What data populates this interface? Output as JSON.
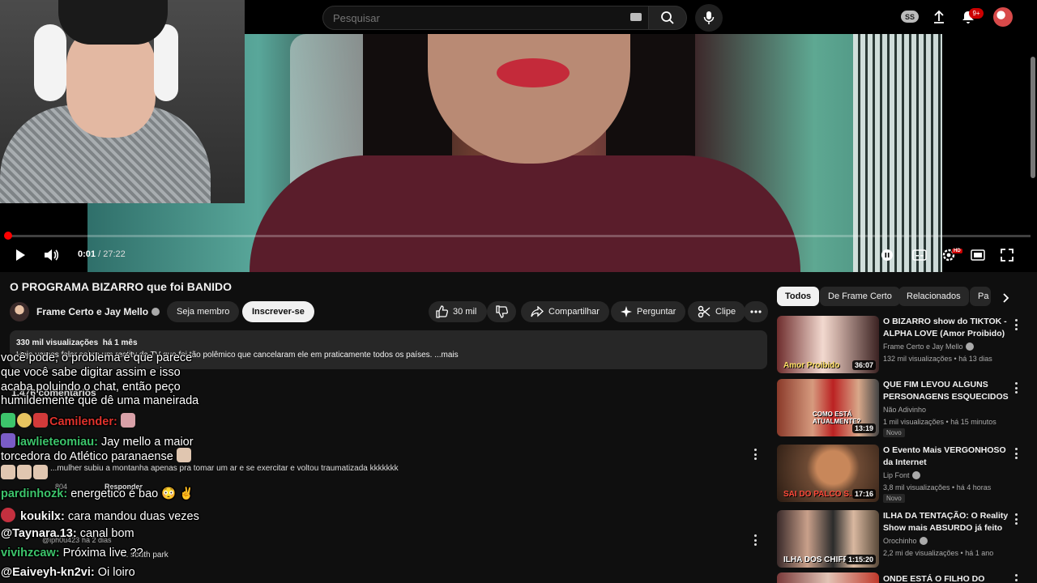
{
  "search": {
    "placeholder": "Pesquisar"
  },
  "topbar": {
    "cast_badge": "SS",
    "notifications": "9+"
  },
  "player": {
    "current_time": "0:01",
    "duration": "27:22",
    "progress": 0.0006
  },
  "video": {
    "title": "O PROGRAMA BIZARRO que foi BANIDO",
    "channel": "Frame Certo e Jay Mello",
    "member_label": "Seja membro",
    "subscribe_label": "Inscrever-se",
    "likes": "30 mil",
    "share_label": "Compartilhar",
    "ask_label": "Perguntar",
    "clip_label": "Clipe",
    "views": "330 mil visualizações",
    "age": "há 1 mês",
    "description": "Hoje vamos falar sobre um reality da TV que foi tão polêmico que cancelaram ele em praticamente todos os países. ...mais"
  },
  "comments": {
    "count_label": "1.476 comentários",
    "items": [
      {
        "text": "...mulher subiu a montanha apenas pra tomar um ar e se exercitar e voltou traumatizada kkkkkkk",
        "likes": "804",
        "reply": "Responder"
      },
      {
        "user": "@iph0u423",
        "age": "há 2 dias",
        "text": "... south park"
      }
    ]
  },
  "chat": [
    {
      "text": "você pode, o problema é que parece"
    },
    {
      "text": "que você sabe digitar assim e isso"
    },
    {
      "text": "acaba poluindo o chat, então peço"
    },
    {
      "text": "humildemente que dê uma maneirada"
    },
    {
      "user": "Camilender:",
      "text": ""
    },
    {
      "user": "lawlieteomiau:",
      "text": "Jay mello a maior"
    },
    {
      "text": "torcedora do Atlético paranaense"
    },
    {
      "user": "pardinhozk:",
      "text": "energetico é bao 😳 ✌"
    },
    {
      "user": "koukilx:",
      "text": "cara mandou duas vezes"
    },
    {
      "user": "@Taynara.13:",
      "text": "canal bom"
    },
    {
      "user": "vivihzcaw:",
      "text": "Próxima live ??"
    },
    {
      "user": "@Eaiveyh-kn2vi:",
      "text": "Oi loiro"
    }
  ],
  "sidebar": {
    "chips": [
      "Todos",
      "De Frame Certo",
      "Relacionados",
      "Pa"
    ],
    "recommendations": [
      {
        "title": "O BIZARRO show do TIKTOK - ALPHA LOVE (Amor Proibido)",
        "channel": "Frame Certo e Jay Mello",
        "views": "132 mil visualizações",
        "age": "há 13 dias",
        "duration": "36:07",
        "thumb_text": "Amor Proibido",
        "badge": ""
      },
      {
        "title": "QUE FIM LEVOU ALGUNS PERSONAGENS ESQUECIDOS ...",
        "channel": "Não Adivinho",
        "views": "1 mil visualizações",
        "age": "há 15 minutos",
        "duration": "13:19",
        "thumb_text": "COMO ESTÁ ATUALMENTE?",
        "badge": "Novo"
      },
      {
        "title": "O Evento Mais VERGONHOSO da Internet",
        "channel": "Lip Font",
        "views": "3,8 mil visualizações",
        "age": "há 4 horas",
        "duration": "17:16",
        "thumb_text": "SAI DO PALCO S...",
        "badge": "Novo"
      },
      {
        "title": "ILHA DA TENTAÇÃO: O Reality Show mais ABSURDO já feito",
        "channel": "Orochinho",
        "views": "2,2 mi de visualizações",
        "age": "há 1 ano",
        "duration": "1:15:20",
        "thumb_text": "ILHA DOS CHIFR...",
        "badge": ""
      },
      {
        "title": "ONDE ESTÁ O FILHO DO",
        "channel": "",
        "views": "",
        "age": "",
        "duration": "",
        "thumb_text": "",
        "badge": ""
      }
    ]
  },
  "colors": {
    "accent_red": "#ff0000",
    "chat_green": "#3cc46b",
    "chat_red": "#e0322c"
  }
}
